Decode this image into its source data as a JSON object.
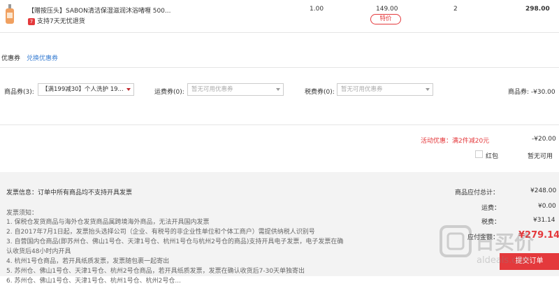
{
  "product": {
    "title": "【赠按压头】SABON清洁保湿滋润沐浴啫喱 500...",
    "return_badge": "7",
    "return_text": "支持7天无忧退货",
    "tax": "1.00",
    "price": "149.00",
    "tag": "特价",
    "quantity": "2",
    "subtotal": "298.00"
  },
  "coupon_section": {
    "label": "优惠券",
    "exchange_link": "兑换优惠券",
    "goods_coupon_label": "商品券(3):",
    "goods_coupon_value": "【满199减30】个人洗护 19...",
    "shipping_coupon_label": "运费券(0):",
    "shipping_coupon_value": "暂无可用优惠券",
    "tax_coupon_label": "税费券(0):",
    "tax_coupon_value": "暂无可用优惠券",
    "goods_coupon_discount": "商品券: -¥30.00"
  },
  "promotion": {
    "label": "活动优惠：满2件减20元",
    "amount": "-¥20.00",
    "red_packet_label": "红包",
    "red_packet_value": "暂无可用"
  },
  "invoice": {
    "info_title": "发票信息：订单中所有商品均不支持开具发票",
    "notes_title": "发票须知：",
    "notes": [
      "1. 保税仓发货商品与海外仓发货商品属跨境海外商品，无法开具国内发票",
      "2. 自2017年7月1日起，发票抬头选择公司（企业、有税号的非企业性单位和个体工商户）需提供纳税人识别号",
      "3. 自营国内仓商品(即苏州仓、佛山1号仓、天津1号仓、杭州1号仓与杭州2号仓的商品)支持开具电子发票，电子发票在确",
      "认收货后48小时内开具",
      "4. 杭州1号仓商品，若开具纸质发票，发票随包裹一起寄出",
      "5. 苏州仓、佛山1号仓、天津1号仓、杭州2号仓商品，若开具纸质发票，发票在确认收货后7-30天单独寄出",
      "6. 苏州仓、佛山1号仓、天津1号仓、杭州1号仓、杭州2号仓..."
    ]
  },
  "summary": {
    "goods_total_label": "商品应付总计：",
    "goods_total": "¥248.00",
    "shipping_label": "运费：",
    "shipping": "¥0.00",
    "tax_label": "税费：",
    "tax": "¥31.14",
    "payable_label": "应付金额：",
    "payable": "¥279.14",
    "submit_label": "提交订单"
  },
  "watermark": {
    "text": "日买价",
    "sub": "aldeals.com"
  },
  "colors": {
    "accent": "#e4393c",
    "link": "#3b7fd3"
  }
}
